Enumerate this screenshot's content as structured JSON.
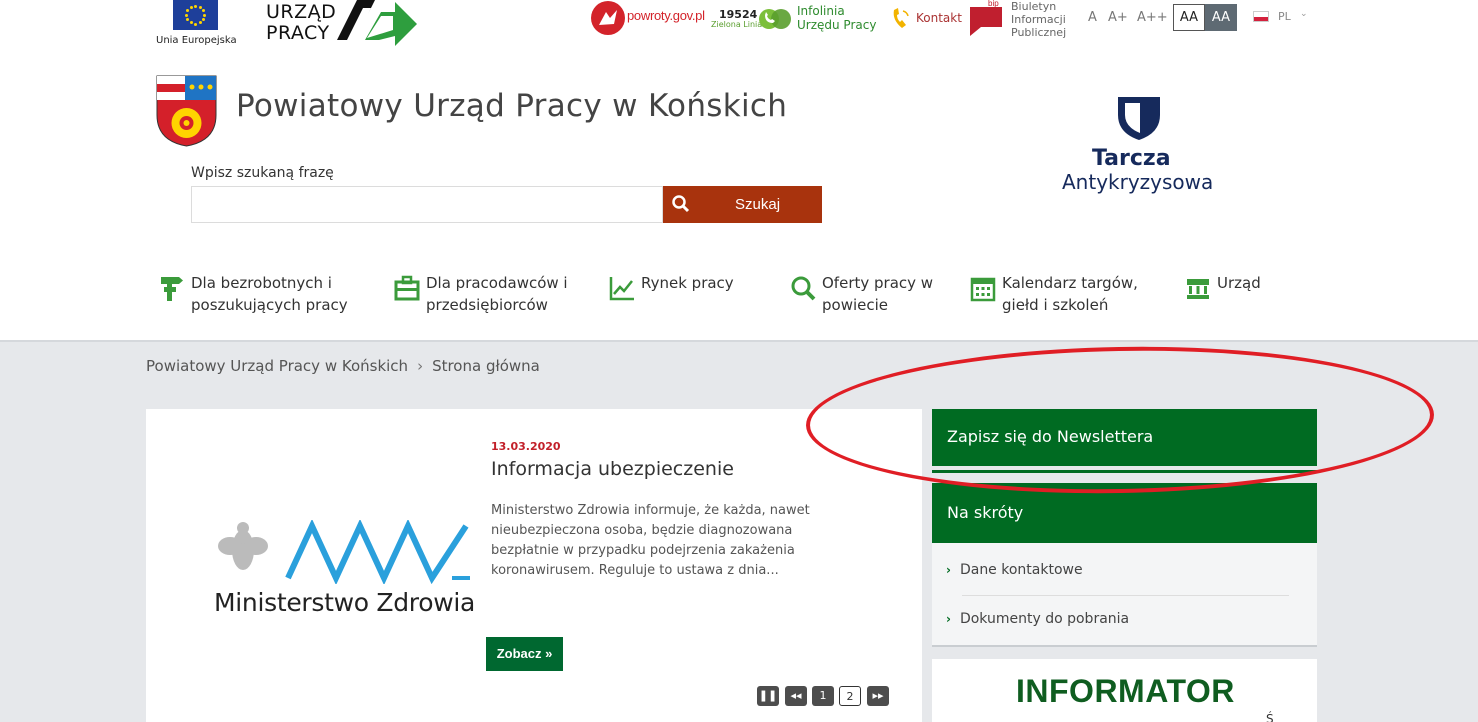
{
  "topbar": {
    "eu_label": "Unia Europejska",
    "up_line1": "URZĄD",
    "up_line2": "PRACY",
    "powroty": "powroty.gov.pl",
    "zl_number": "19524",
    "zl_label": "Zielona Linia",
    "infolinia_line1": "Infolinia",
    "infolinia_line2": "Urzędu Pracy",
    "kontakt": "Kontakt",
    "bip_icon_text": "bip",
    "bip_line1": "Biuletyn",
    "bip_line2": "Informacji",
    "bip_line3": "Publicznej",
    "font_small": "A",
    "font_medium": "A+",
    "font_large": "A++",
    "contrast_normal": "AA",
    "contrast_high": "AA",
    "language": "PL"
  },
  "header": {
    "site_title": "Powiatowy Urząd Pracy w Końskich",
    "search_label": "Wpisz szukaną frazę",
    "search_value": "",
    "search_button": "Szukaj",
    "tarcza_title": "Tarcza",
    "tarcza_sub": "Antykryzysowa"
  },
  "nav": [
    {
      "line1": "Dla bezrobotnych i",
      "line2": "poszukujących pracy"
    },
    {
      "line1": "Dla pracodawców i",
      "line2": "przedsiębiorców"
    },
    {
      "line1": "Rynek pracy",
      "line2": ""
    },
    {
      "line1": "Oferty pracy w",
      "line2": "powiecie"
    },
    {
      "line1": "Kalendarz targów,",
      "line2": "giełd i szkoleń"
    },
    {
      "line1": "Urząd",
      "line2": ""
    }
  ],
  "breadcrumb": {
    "home": "Powiatowy Urząd Pracy w Końskich",
    "separator": "›",
    "current": "Strona główna"
  },
  "slider": {
    "image_text": "Ministerstwo Zdrowia",
    "date": "13.03.2020",
    "title": "Informacja ubezpieczenie",
    "body": "Ministerstwo Zdrowia informuje, że każda, nawet nieubezpieczona osoba, będzie diagnozowana bezpłatnie w przypadku podejrzenia zakażenia koronawirusem. Reguluje to ustawa z dnia...",
    "button": "Zobacz »",
    "pause": "❚❚",
    "prev": "◂◂",
    "page1": "1",
    "page2": "2",
    "next": "▸▸"
  },
  "sidebar": {
    "newsletter": "Zapisz się do Newslettera",
    "skroty_title": "Na skróty",
    "skroty_items": [
      "Dane kontaktowe",
      "Dokumenty do pobrania"
    ],
    "arrow": "›",
    "informator": "INFORMATOR",
    "informator_cut": "Ś"
  },
  "colors": {
    "green": "#006b22",
    "search_button": "#a8330d",
    "annotation": "#e01e25"
  }
}
